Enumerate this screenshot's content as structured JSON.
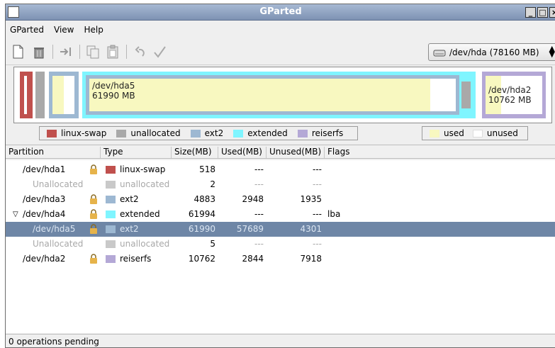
{
  "window": {
    "title": "GParted"
  },
  "menu": {
    "gparted": "GParted",
    "view": "View",
    "help": "Help"
  },
  "toolbar": {
    "icons": [
      "new-icon",
      "delete-icon",
      "resize-icon",
      "copy-icon",
      "paste-icon",
      "undo-icon",
      "apply-icon"
    ],
    "device": "/dev/hda (78160 MB)"
  },
  "map": {
    "hda5": {
      "name": "/dev/hda5",
      "size": "61990 MB"
    },
    "hda2": {
      "name": "/dev/hda2",
      "size": "10762 MB"
    }
  },
  "legend": {
    "fs": [
      "linux-swap",
      "unallocated",
      "ext2",
      "extended",
      "reiserfs"
    ],
    "usage": [
      "used",
      "unused"
    ]
  },
  "colors": {
    "linux-swap": "#c0504d",
    "unallocated": "#a9a9a9",
    "ext2": "#9db8d2",
    "extended": "#7ff5ff",
    "reiserfs": "#b4a8d6",
    "used": "#f8f8c0",
    "selection": "#6e86a6"
  },
  "table": {
    "headers": {
      "partition": "Partition",
      "type": "Type",
      "size": "Size(MB)",
      "used": "Used(MB)",
      "unused": "Unused(MB)",
      "flags": "Flags"
    },
    "rows": [
      {
        "partition": "/dev/hda1",
        "type": "linux-swap",
        "size": "518",
        "used": "---",
        "unused": "---",
        "flags": ""
      },
      {
        "partition": "Unallocated",
        "type": "unallocated",
        "size": "2",
        "used": "---",
        "unused": "---",
        "flags": ""
      },
      {
        "partition": "/dev/hda3",
        "type": "ext2",
        "size": "4883",
        "used": "2948",
        "unused": "1935",
        "flags": ""
      },
      {
        "partition": "/dev/hda4",
        "type": "extended",
        "size": "61994",
        "used": "---",
        "unused": "---",
        "flags": "lba"
      },
      {
        "partition": "/dev/hda5",
        "type": "ext2",
        "size": "61990",
        "used": "57689",
        "unused": "4301",
        "flags": ""
      },
      {
        "partition": "Unallocated",
        "type": "unallocated",
        "size": "5",
        "used": "---",
        "unused": "---",
        "flags": ""
      },
      {
        "partition": "/dev/hda2",
        "type": "reiserfs",
        "size": "10762",
        "used": "2844",
        "unused": "7918",
        "flags": ""
      }
    ]
  },
  "status": {
    "text": "0 operations pending"
  }
}
